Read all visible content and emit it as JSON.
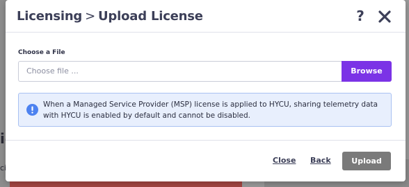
{
  "background": {
    "left_letter": "ic",
    "left_small": "ci"
  },
  "dialog": {
    "title": {
      "parent": "Licensing",
      "separator": ">",
      "current": "Upload License"
    },
    "help_icon": "question-mark-icon",
    "close_icon": "close-icon"
  },
  "file_field": {
    "label": "Choose a File",
    "placeholder": "Choose file ...",
    "value": "",
    "browse_label": "Browse"
  },
  "notice": {
    "icon": "info-icon",
    "text": "When a Managed Service Provider (MSP) license is applied to HYCU, sharing telemetry data with HYCU is enabled by default and cannot be disabled."
  },
  "footer": {
    "close_label": "Close",
    "back_label": "Back",
    "upload_label": "Upload"
  },
  "colors": {
    "accent": "#7b33e6",
    "info_bg": "#e8effd",
    "info_border": "#a9c1f2",
    "info_icon": "#4d82f0",
    "disabled_button": "#7a7a7a",
    "background_red": "#a44542"
  }
}
